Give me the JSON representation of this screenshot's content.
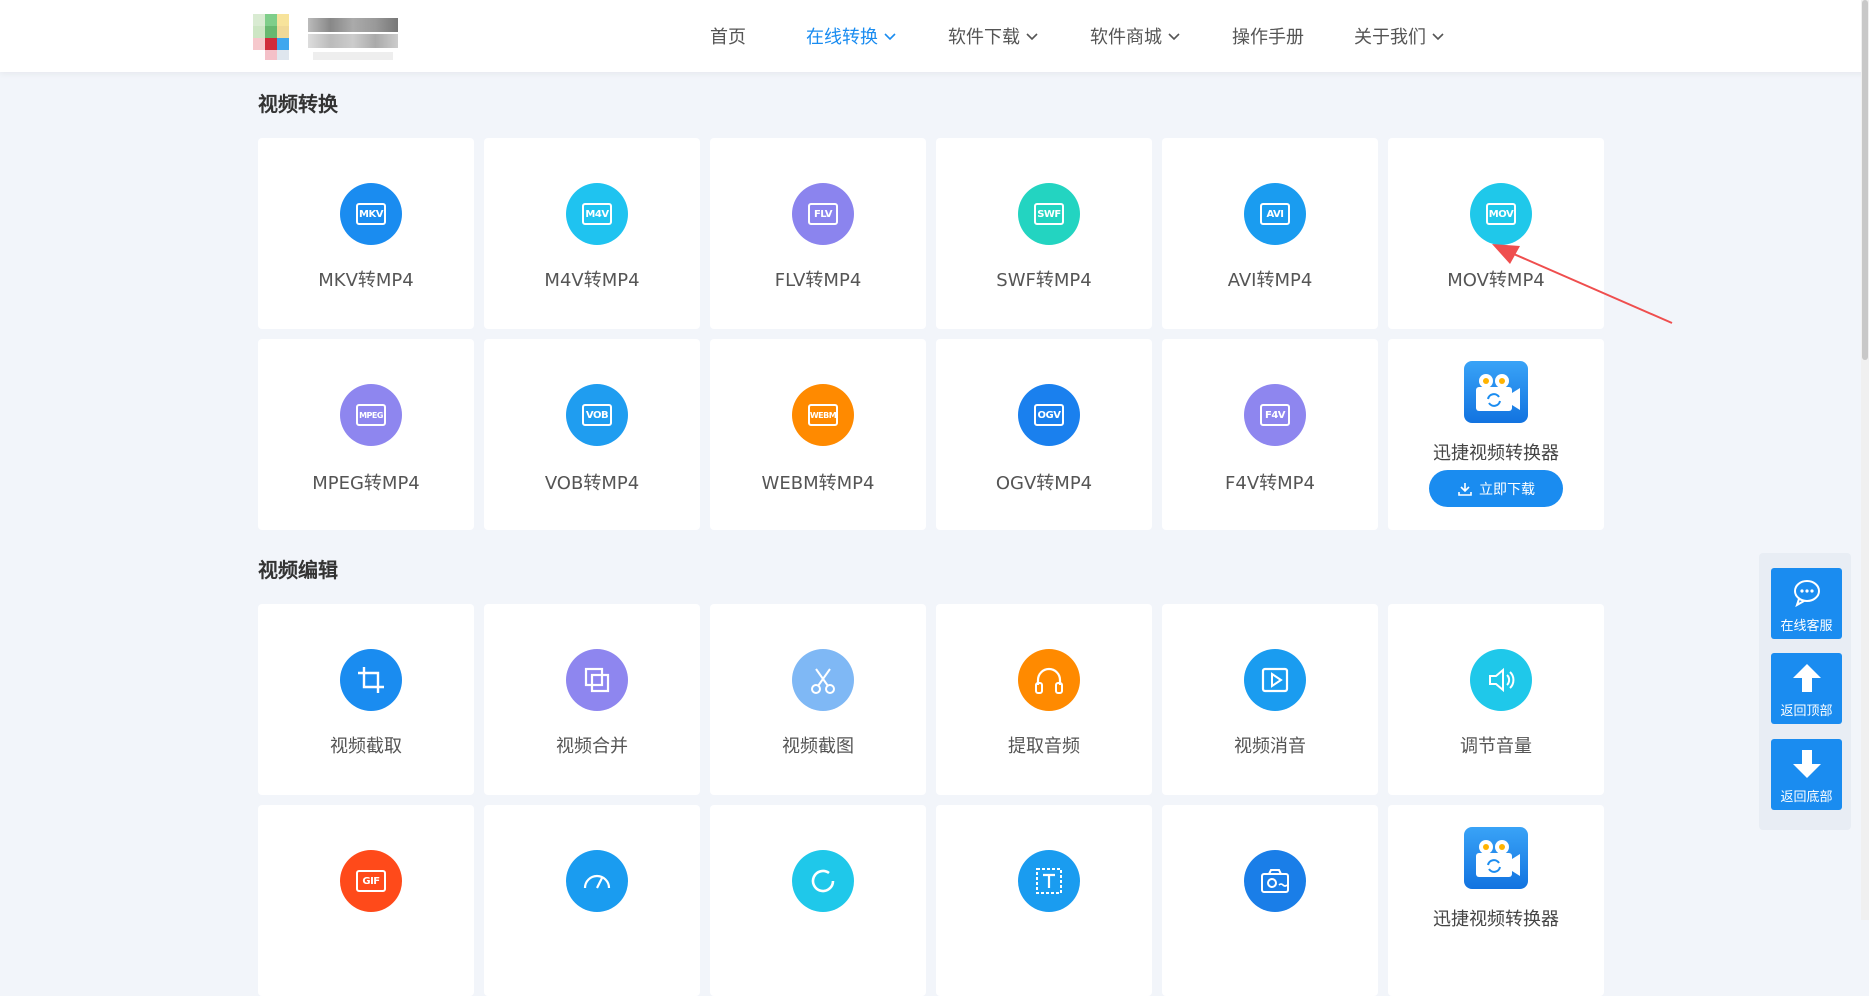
{
  "nav": {
    "items": [
      {
        "label": "首页",
        "dropdown": false,
        "active": false
      },
      {
        "label": "在线转换",
        "dropdown": true,
        "active": true
      },
      {
        "label": "软件下载",
        "dropdown": true,
        "active": false
      },
      {
        "label": "软件商城",
        "dropdown": true,
        "active": false
      },
      {
        "label": "操作手册",
        "dropdown": false,
        "active": false
      },
      {
        "label": "关于我们",
        "dropdown": true,
        "active": false
      }
    ]
  },
  "sections": {
    "video_convert": {
      "title": "视频转换",
      "cards": [
        {
          "badge": "MKV",
          "label": "MKV转MP4",
          "color": "#1a8cf0"
        },
        {
          "badge": "M4V",
          "label": "M4V转MP4",
          "color": "#1fc3f0"
        },
        {
          "badge": "FLV",
          "label": "FLV转MP4",
          "color": "#8b84ee"
        },
        {
          "badge": "SWF",
          "label": "SWF转MP4",
          "color": "#23d4c1"
        },
        {
          "badge": "AVI",
          "label": "AVI转MP4",
          "color": "#1a9cf0"
        },
        {
          "badge": "MOV",
          "label": "MOV转MP4",
          "color": "#1fc8ea"
        },
        {
          "badge": "MPEG",
          "label": "MPEG转MP4",
          "color": "#8e86ef"
        },
        {
          "badge": "VOB",
          "label": "VOB转MP4",
          "color": "#1f9df0"
        },
        {
          "badge": "WEBM",
          "label": "WEBM转MP4",
          "color": "#ff8a00"
        },
        {
          "badge": "OGV",
          "label": "OGV转MP4",
          "color": "#1a80ee"
        },
        {
          "badge": "F4V",
          "label": "F4V转MP4",
          "color": "#8e86ef"
        }
      ],
      "promo": {
        "label": "迅捷视频转换器",
        "button": "立即下载"
      }
    },
    "video_edit": {
      "title": "视频编辑",
      "cards": [
        {
          "icon": "crop-icon",
          "label": "视频截取",
          "color": "#1a8cf0"
        },
        {
          "icon": "merge-icon",
          "label": "视频合并",
          "color": "#8e86ef"
        },
        {
          "icon": "scissors-icon",
          "label": "视频截图",
          "color": "#7fb8f5"
        },
        {
          "icon": "headphones-icon",
          "label": "提取音频",
          "color": "#ff8a00"
        },
        {
          "icon": "play-icon",
          "label": "视频消音",
          "color": "#1a9cf0"
        },
        {
          "icon": "volume-icon",
          "label": "调节音量",
          "color": "#1fc8ea"
        }
      ],
      "row2": [
        {
          "icon": "gif-icon",
          "badge": "GIF",
          "color": "#ff4a1a"
        },
        {
          "icon": "speed-icon",
          "color": "#1a9cf0"
        },
        {
          "icon": "rotate-icon",
          "color": "#1fc8ea"
        },
        {
          "icon": "text-icon",
          "color": "#1a9cf0"
        },
        {
          "icon": "camera-icon",
          "color": "#1a7ee8"
        }
      ],
      "promo": {
        "label": "迅捷视频转换器"
      }
    }
  },
  "float": {
    "service": "在线客服",
    "top": "返回顶部",
    "bottom": "返回底部"
  }
}
